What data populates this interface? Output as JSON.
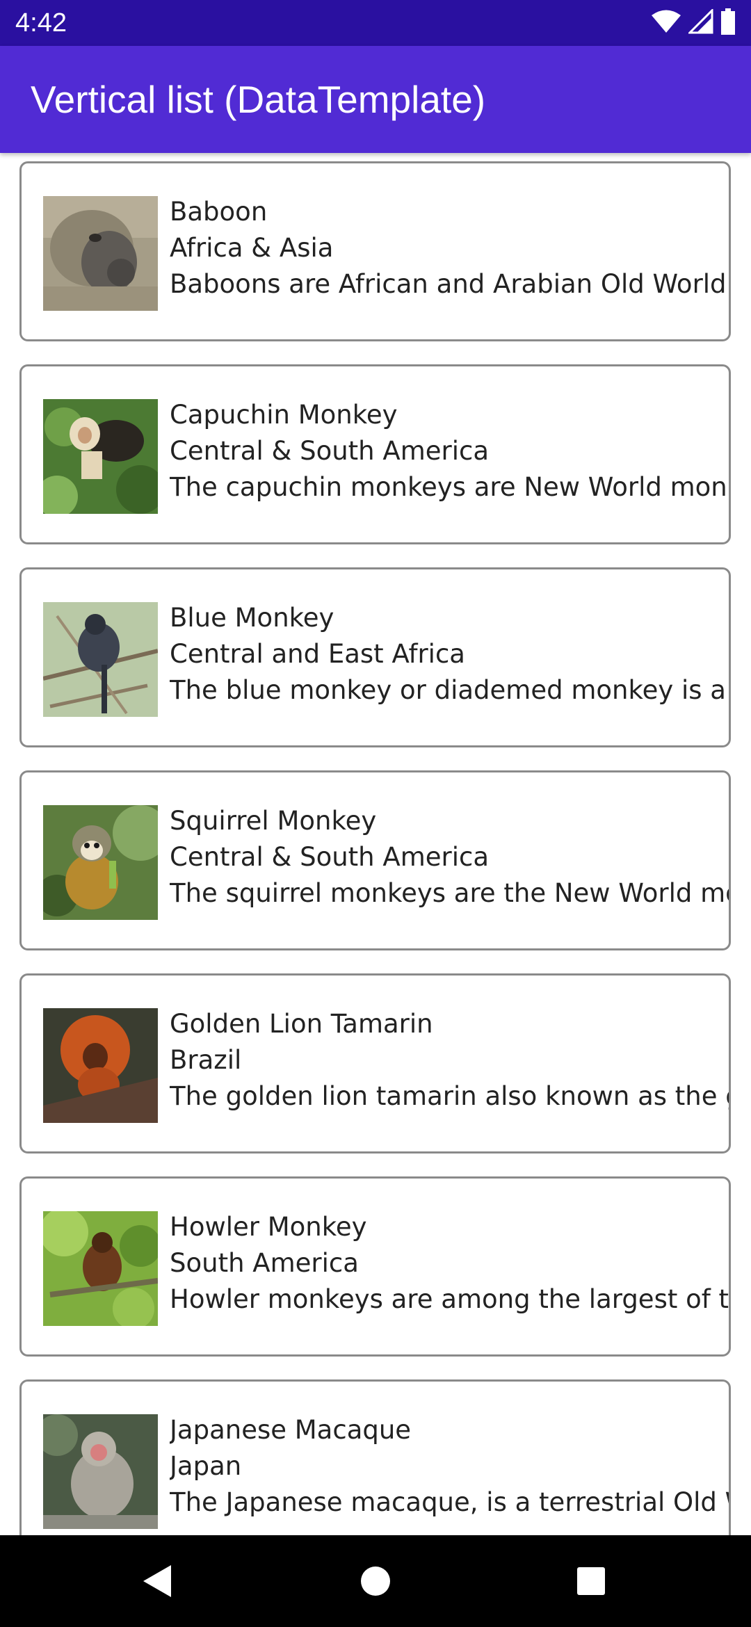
{
  "status_bar": {
    "time": "4:42",
    "icons": [
      "wifi-icon",
      "cell-signal-icon",
      "battery-icon"
    ]
  },
  "app_bar": {
    "title": "Vertical list (DataTemplate)",
    "color": "#512bd4"
  },
  "monkeys": [
    {
      "name": "Baboon",
      "location": "Africa & Asia",
      "details": "Baboons are African and Arabian Old World m",
      "image": "baboon-photo"
    },
    {
      "name": "Capuchin Monkey",
      "location": "Central & South America",
      "details": "The capuchin monkeys are New World monke",
      "image": "capuchin-monkey-photo"
    },
    {
      "name": "Blue Monkey",
      "location": "Central and East Africa",
      "details": "The blue monkey or diademed monkey is a sp",
      "image": "blue-monkey-photo"
    },
    {
      "name": "Squirrel Monkey",
      "location": "Central & South America",
      "details": "The squirrel monkeys are the New World mor",
      "image": "squirrel-monkey-photo"
    },
    {
      "name": "Golden Lion Tamarin",
      "location": "Brazil",
      "details": "The golden lion tamarin also known as the go",
      "image": "golden-lion-tamarin-photo"
    },
    {
      "name": "Howler Monkey",
      "location": "South America",
      "details": "Howler monkeys are among the largest of the",
      "image": "howler-monkey-photo"
    },
    {
      "name": "Japanese Macaque",
      "location": "Japan",
      "details": "The Japanese macaque, is a terrestrial Old Wo",
      "image": "japanese-macaque-photo"
    }
  ],
  "nav_bar": {
    "buttons": [
      "back-icon",
      "home-icon",
      "recents-icon"
    ]
  }
}
